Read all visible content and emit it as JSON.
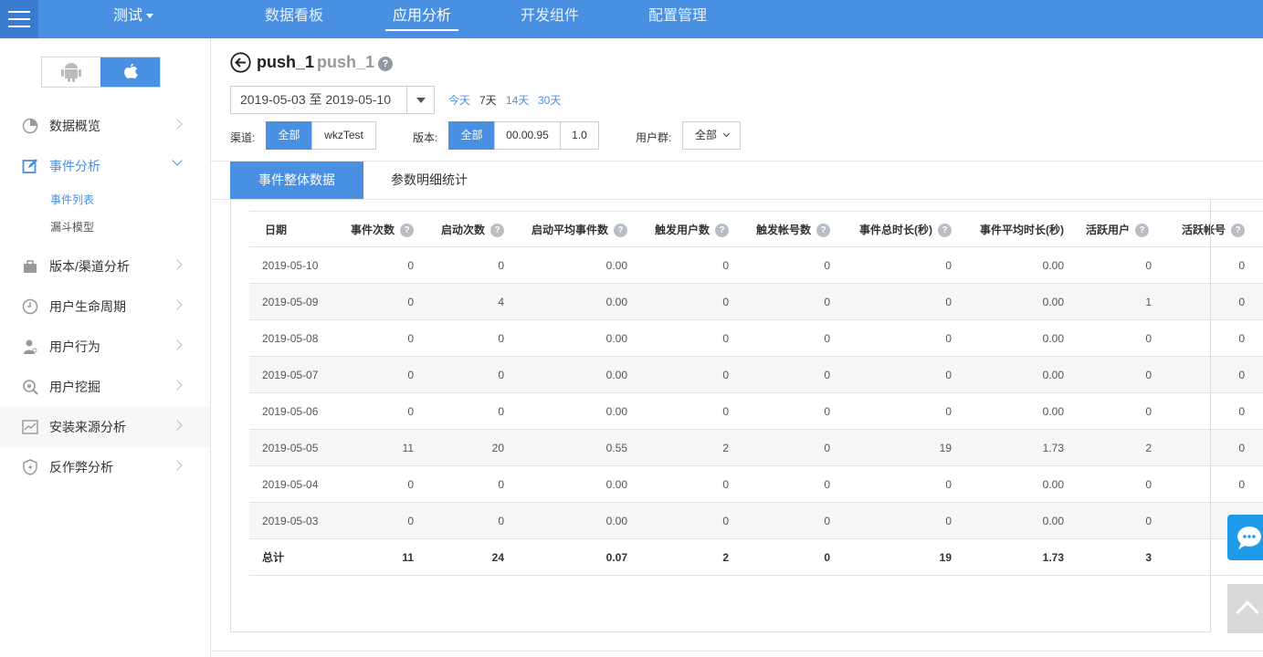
{
  "topbar": {
    "app_name": "测试",
    "nav": [
      "数据看板",
      "应用分析",
      "开发组件",
      "配置管理"
    ],
    "active_nav": "应用分析"
  },
  "sidebar": {
    "items": [
      {
        "label": "数据概览",
        "icon": "pie-chart-icon"
      },
      {
        "label": "事件分析",
        "icon": "edit-icon",
        "expanded": true
      },
      {
        "label": "版本/渠道分析",
        "icon": "briefcase-icon"
      },
      {
        "label": "用户生命周期",
        "icon": "clock-icon"
      },
      {
        "label": "用户行为",
        "icon": "user-icon"
      },
      {
        "label": "用户挖掘",
        "icon": "magnify-icon"
      },
      {
        "label": "安装来源分析",
        "icon": "trend-icon"
      },
      {
        "label": "反作弊分析",
        "icon": "shield-icon"
      }
    ],
    "sub_items": [
      {
        "label": "事件列表",
        "active": true
      },
      {
        "label": "漏斗模型",
        "active": false
      }
    ]
  },
  "header": {
    "title": "push_1",
    "subtitle": "push_1",
    "help": "?"
  },
  "date_range": {
    "value": "2019-05-03 至 2019-05-10",
    "quick": [
      "今天",
      "7天",
      "14天",
      "30天"
    ],
    "active_quick": "7天"
  },
  "filters": {
    "channel_label": "渠道:",
    "channels": [
      "全部",
      "wkzTest"
    ],
    "version_label": "版本:",
    "versions": [
      "全部",
      "00.00.95",
      "1.0"
    ],
    "group_label": "用户群:",
    "group_value": "全部"
  },
  "tabs": [
    "事件整体数据",
    "参数明细统计"
  ],
  "table": {
    "columns": [
      "日期",
      "事件次数",
      "启动次数",
      "启动平均事件数",
      "触发用户数",
      "触发帐号数",
      "事件总时长(秒)",
      "事件平均时长(秒)",
      "活跃用户",
      "活跃帐号"
    ],
    "rows": [
      [
        "2019-05-10",
        "0",
        "0",
        "0.00",
        "0",
        "0",
        "0",
        "0.00",
        "0",
        "0"
      ],
      [
        "2019-05-09",
        "0",
        "4",
        "0.00",
        "0",
        "0",
        "0",
        "0.00",
        "1",
        "0"
      ],
      [
        "2019-05-08",
        "0",
        "0",
        "0.00",
        "0",
        "0",
        "0",
        "0.00",
        "0",
        "0"
      ],
      [
        "2019-05-07",
        "0",
        "0",
        "0.00",
        "0",
        "0",
        "0",
        "0.00",
        "0",
        "0"
      ],
      [
        "2019-05-06",
        "0",
        "0",
        "0.00",
        "0",
        "0",
        "0",
        "0.00",
        "0",
        "0"
      ],
      [
        "2019-05-05",
        "11",
        "20",
        "0.55",
        "2",
        "0",
        "19",
        "1.73",
        "2",
        "0"
      ],
      [
        "2019-05-04",
        "0",
        "0",
        "0.00",
        "0",
        "0",
        "0",
        "0.00",
        "0",
        "0"
      ],
      [
        "2019-05-03",
        "0",
        "0",
        "0.00",
        "0",
        "0",
        "0",
        "0.00",
        "0",
        ""
      ]
    ],
    "total": [
      "总计",
      "11",
      "24",
      "0.07",
      "2",
      "0",
      "19",
      "1.73",
      "3",
      ""
    ]
  },
  "colors": {
    "primary": "#4a90e2",
    "chat": "#1e9be8"
  }
}
